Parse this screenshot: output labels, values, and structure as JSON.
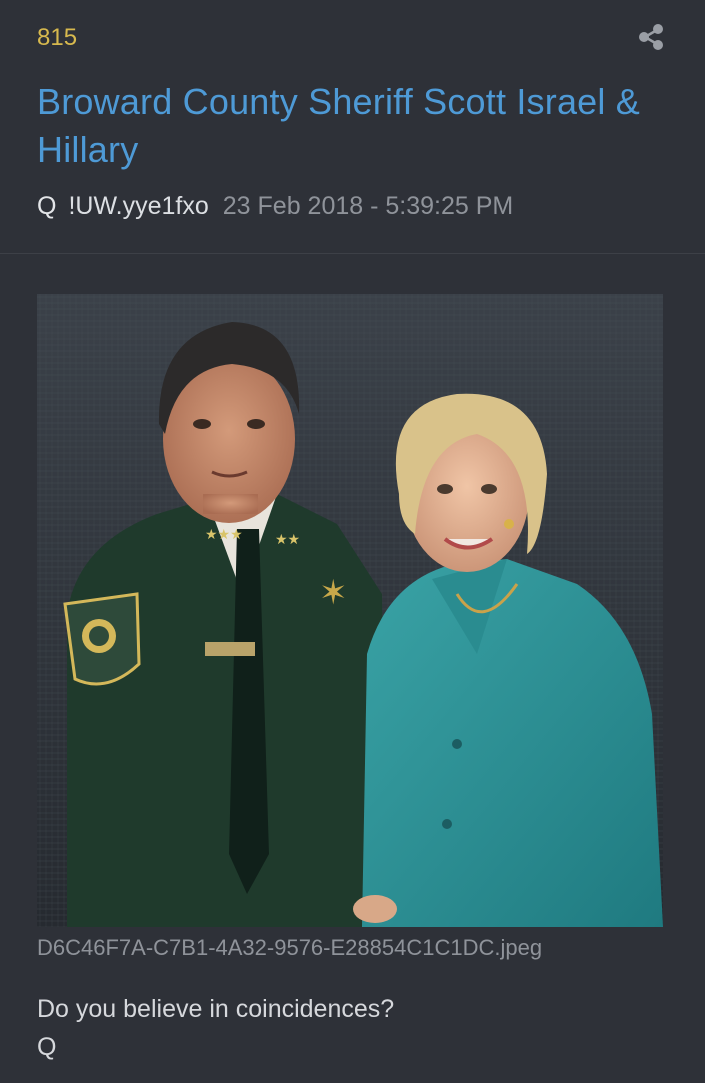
{
  "post": {
    "number": "815",
    "title": "Broward County Sheriff Scott Israel & Hillary",
    "author": "Q",
    "tripcode": "!UW.yye1fxo",
    "timestamp": "23 Feb 2018 - 5:39:25 PM",
    "image_filename": "D6C46F7A-C7B1-4A32-9576-E28854C1C1DC.jpeg",
    "body_lines": [
      "Do you believe in coincidences?",
      "Q"
    ],
    "share_icon": "share-icon"
  },
  "colors": {
    "background": "#2e3138",
    "post_number": "#d7b94e",
    "title": "#4e9ad6",
    "muted": "#8f939a"
  }
}
